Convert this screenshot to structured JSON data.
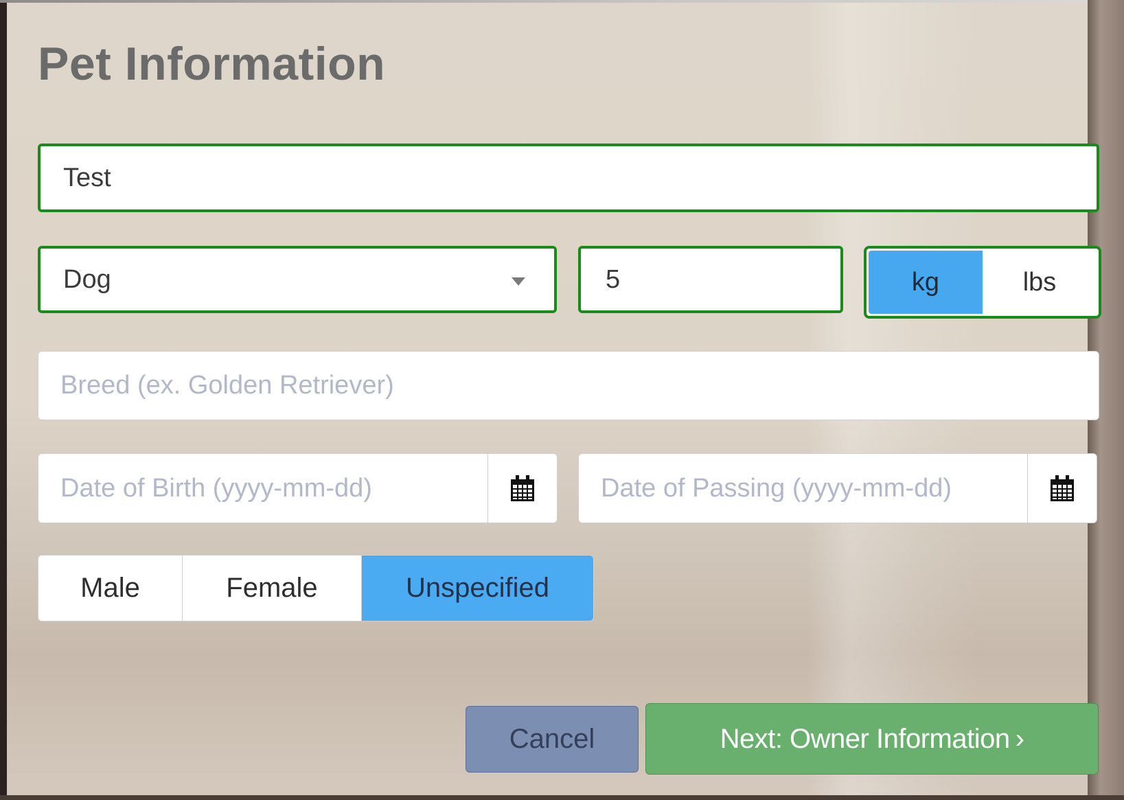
{
  "form": {
    "title": "Pet Information",
    "pet_name": {
      "value": "Test"
    },
    "species": {
      "selected": "Dog"
    },
    "weight": {
      "value": "5"
    },
    "weight_unit": {
      "options": [
        "kg",
        "lbs"
      ],
      "selected": "kg"
    },
    "breed": {
      "placeholder": "Breed (ex. Golden Retriever)"
    },
    "date_of_birth": {
      "placeholder": "Date of Birth (yyyy-mm-dd)"
    },
    "date_of_passing": {
      "placeholder": "Date of Passing (yyyy-mm-dd)"
    },
    "sex": {
      "options": [
        "Male",
        "Female",
        "Unspecified"
      ],
      "selected": "Unspecified"
    }
  },
  "actions": {
    "cancel_label": "Cancel",
    "next_label": "Next: Owner Information",
    "next_chevron": "›"
  },
  "colors": {
    "valid_border": "#1a8a1a",
    "active_toggle": "#47a8f0",
    "cancel_bg": "#7c8fb3",
    "next_bg": "#69b06f"
  },
  "icons": {
    "species_dropdown": "caret-down-icon",
    "date_picker": "calendar-icon"
  }
}
